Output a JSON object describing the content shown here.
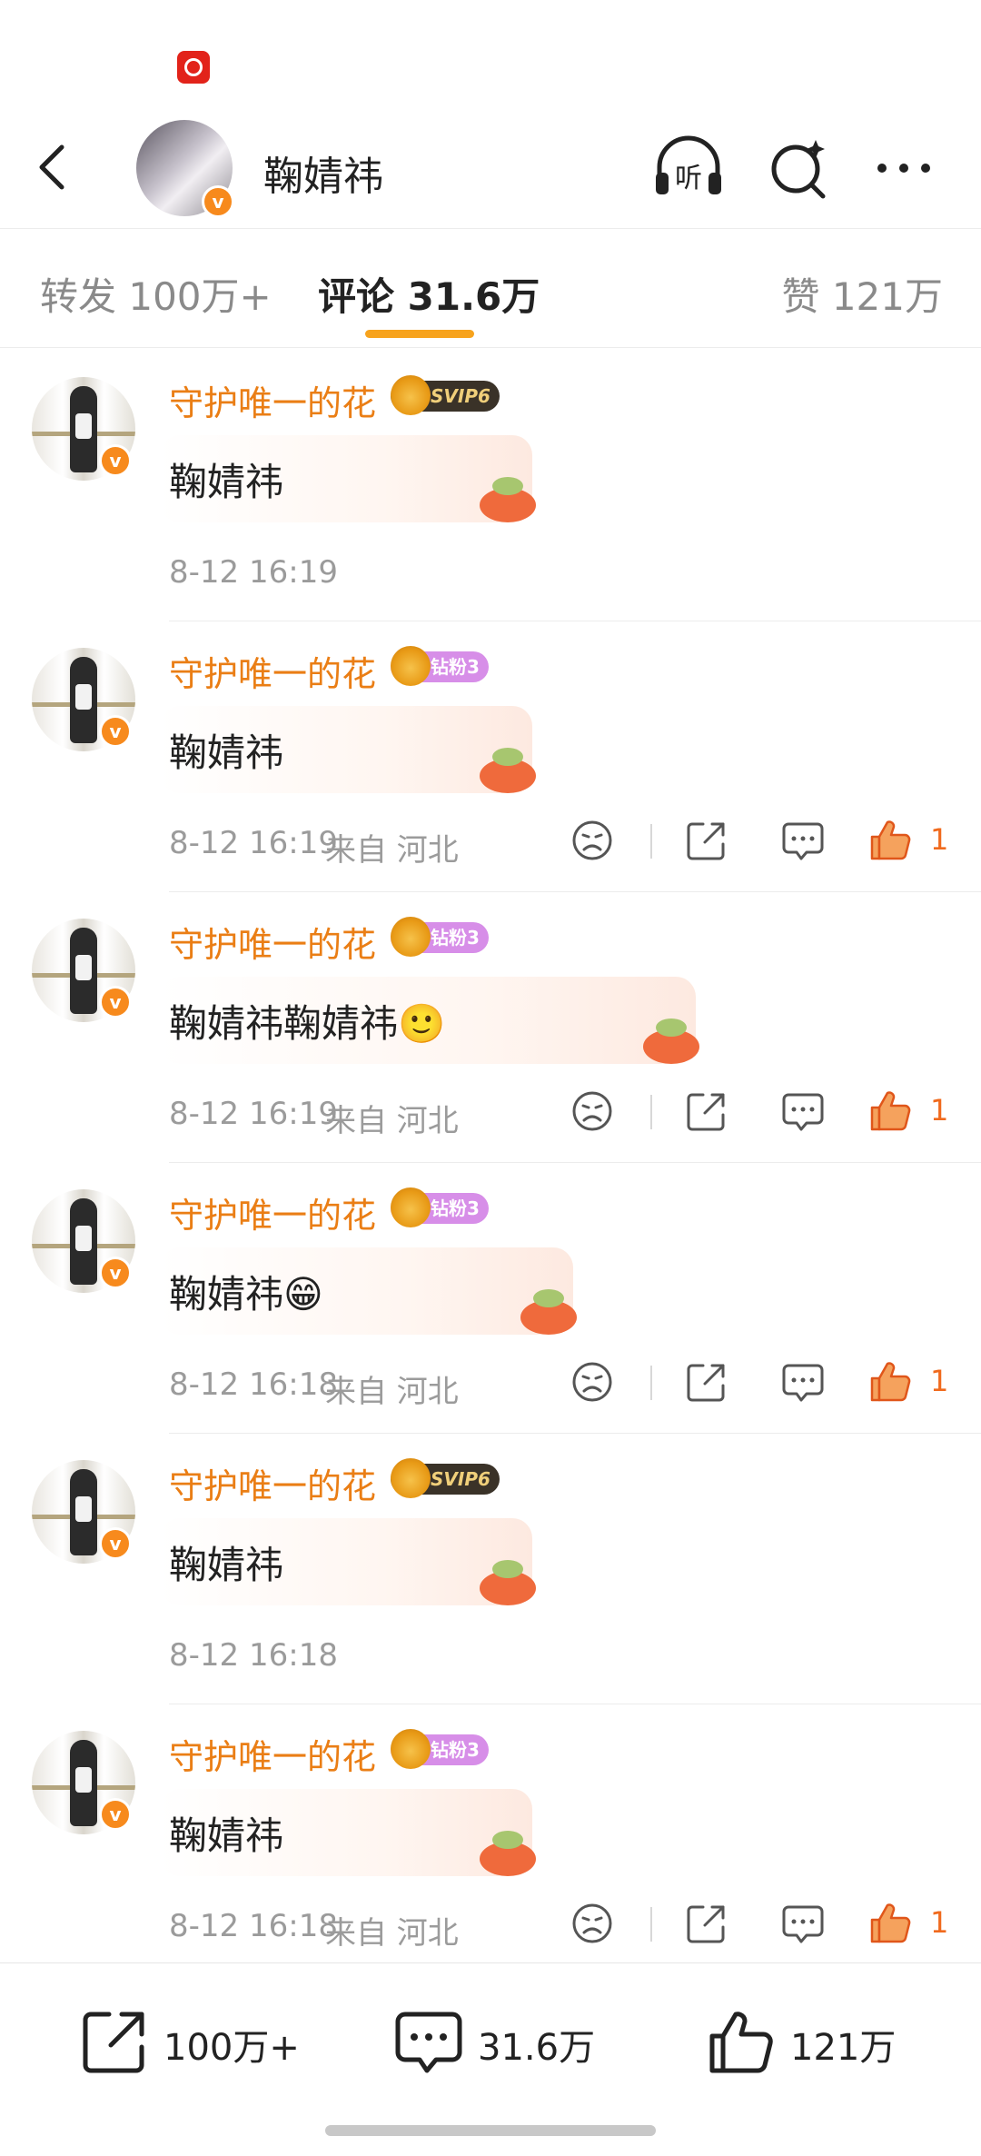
{
  "header": {
    "title": "鞠婧祎",
    "listen_label": "听"
  },
  "tabs": {
    "repost": "转发 100万+",
    "comments": "评论 31.6万",
    "likes": "赞 121万"
  },
  "comments": [
    {
      "user": "守护唯一的花",
      "badge_type": "svip",
      "badge_text": "SVIP6",
      "text": "鞠婧祎",
      "time": "8-12 16:19",
      "location": "",
      "likes": "",
      "show_actions": false
    },
    {
      "user": "守护唯一的花",
      "badge_type": "fan",
      "badge_text": "钻粉3",
      "text": "鞠婧祎",
      "time": "8-12 16:19",
      "location": "来自 河北",
      "likes": "1",
      "show_actions": true
    },
    {
      "user": "守护唯一的花",
      "badge_type": "fan",
      "badge_text": "钻粉3",
      "text": "鞠婧祎鞠婧祎🙂",
      "time": "8-12 16:19",
      "location": "来自 河北",
      "likes": "1",
      "show_actions": true
    },
    {
      "user": "守护唯一的花",
      "badge_type": "fan",
      "badge_text": "钻粉3",
      "text": "鞠婧祎😁",
      "time": "8-12 16:18",
      "location": "来自 河北",
      "likes": "1",
      "show_actions": true
    },
    {
      "user": "守护唯一的花",
      "badge_type": "svip",
      "badge_text": "SVIP6",
      "text": "鞠婧祎",
      "time": "8-12 16:18",
      "location": "",
      "likes": "",
      "show_actions": false
    },
    {
      "user": "守护唯一的花",
      "badge_type": "fan",
      "badge_text": "钻粉3",
      "text": "鞠婧祎",
      "time": "8-12 16:18",
      "location": "来自 河北",
      "likes": "1",
      "show_actions": true
    }
  ],
  "bottom_bar": {
    "repost_label": "100万+",
    "comment_label": "31.6万",
    "like_label": "121万"
  },
  "colors": {
    "accent": "#f7a31d",
    "username": "#ea7e15",
    "like": "#f06a1d"
  }
}
